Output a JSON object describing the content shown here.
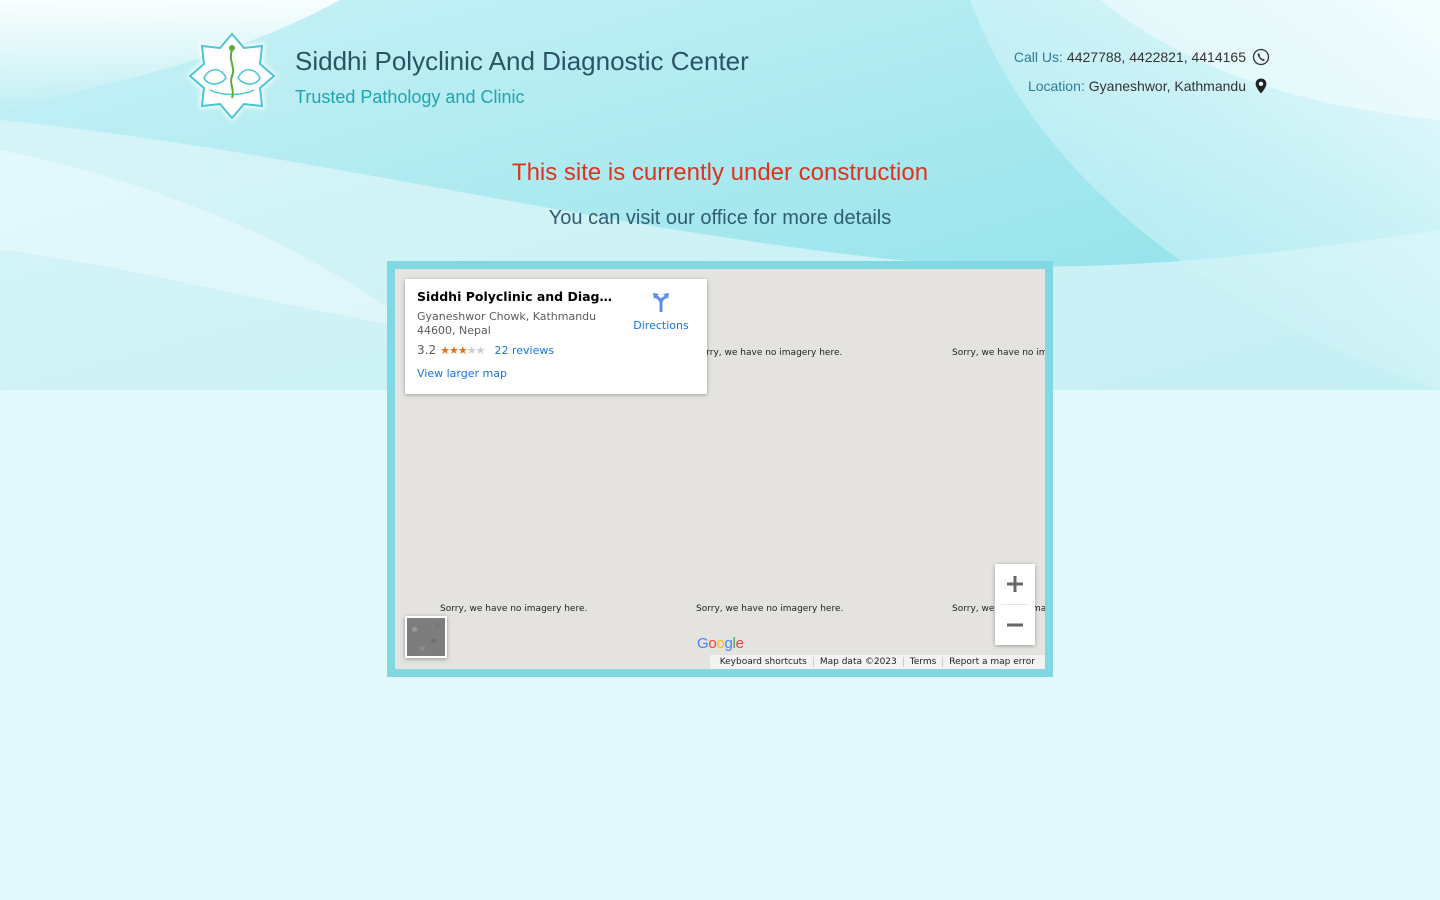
{
  "header": {
    "title": "Siddhi Polyclinic And Diagnostic Center",
    "tagline": "Trusted Pathology and Clinic",
    "phone_label": "Call Us:",
    "phone_value": "4427788, 4422821, 4414165",
    "location_label": "Location:",
    "location_value": "Gyaneshwor, Kathmandu"
  },
  "notice": {
    "headline": "This site is currently under construction",
    "subline": "You can visit our office for more details"
  },
  "map": {
    "place_name": "Siddhi Polyclinic and Diagnos…",
    "address": "Gyaneshwor Chowk, Kathmandu 44600, Nepal",
    "rating": "3.2",
    "stars_filled": 3,
    "stars_total": 5,
    "reviews": "22 reviews",
    "view_larger": "View larger map",
    "directions": "Directions",
    "no_imagery": "Sorry, we have no imagery here.",
    "no_imagery_cut": "Sorry, we have no ima",
    "no_imagery_cut_b": "Sorry, we h",
    "no_imagery_cut_b_tail": "ma",
    "google_logo": "Google",
    "footer": {
      "shortcuts": "Keyboard shortcuts",
      "map_data": "Map data ©2023",
      "terms": "Terms",
      "report": "Report a map error"
    }
  },
  "colors": {
    "title": "#2a5466",
    "tagline": "#1fa6ad",
    "headline": "#e0321c",
    "subline": "#2f5d72",
    "frame": "#7fd8e2"
  }
}
